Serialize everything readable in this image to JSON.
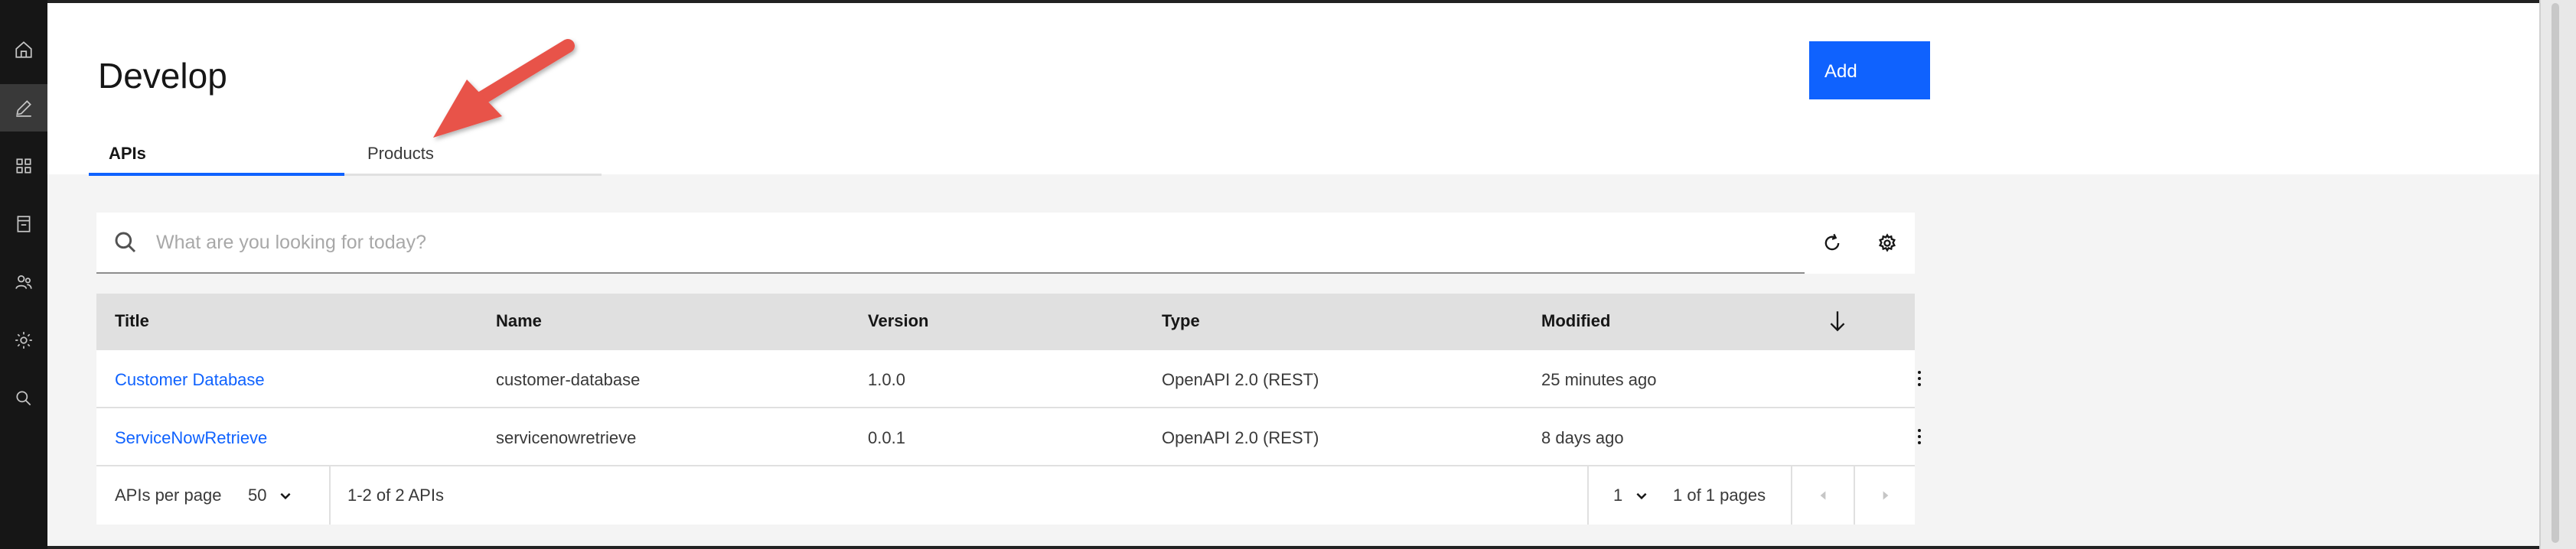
{
  "page": {
    "title": "Develop"
  },
  "nav": {
    "items": [
      {
        "icon": "home-icon"
      },
      {
        "icon": "edit-icon",
        "active": true
      },
      {
        "icon": "apps-grid-icon"
      },
      {
        "icon": "catalog-icon"
      },
      {
        "icon": "members-icon"
      },
      {
        "icon": "settings-icon"
      },
      {
        "icon": "search-icon"
      }
    ]
  },
  "toolbar": {
    "add_label": "Add"
  },
  "tabs": [
    {
      "label": "APIs",
      "selected": true
    },
    {
      "label": "Products",
      "selected": false
    }
  ],
  "search": {
    "placeholder": "What are you looking for today?"
  },
  "table": {
    "columns": [
      "Title",
      "Name",
      "Version",
      "Type",
      "Modified"
    ],
    "rows": [
      {
        "title": "Customer Database",
        "name": "customer-database",
        "version": "1.0.0",
        "type": "OpenAPI 2.0 (REST)",
        "modified": "25 minutes ago"
      },
      {
        "title": "ServiceNowRetrieve",
        "name": "servicenowretrieve",
        "version": "0.0.1",
        "type": "OpenAPI 2.0 (REST)",
        "modified": "8 days ago"
      }
    ]
  },
  "pagination": {
    "per_page_label": "APIs per page",
    "per_page_value": "50",
    "range_text": "1-2 of 2 APIs",
    "page_value": "1",
    "pages_text": "1 of 1 pages"
  },
  "colors": {
    "accent": "#0f62fe",
    "annotation_arrow": "#e8524a"
  }
}
